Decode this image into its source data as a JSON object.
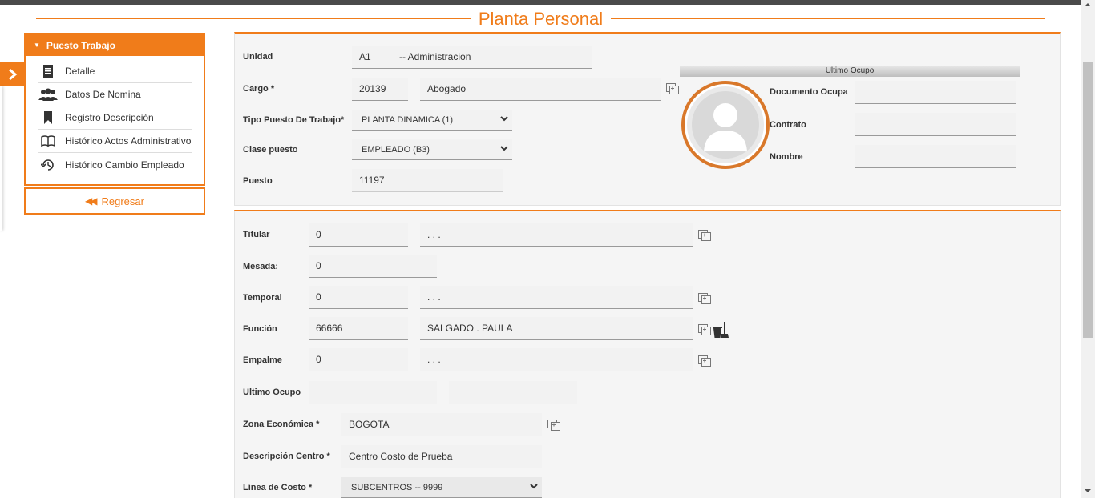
{
  "page": {
    "title": "Planta Personal"
  },
  "sidebar": {
    "header": "Puesto Trabajo",
    "items": [
      {
        "label": "Detalle",
        "icon": "document-icon"
      },
      {
        "label": "Datos De Nomina",
        "icon": "users-icon"
      },
      {
        "label": "Registro Descripción",
        "icon": "bookmark-icon"
      },
      {
        "label": "Histórico Actos Administrativo",
        "icon": "book-icon"
      },
      {
        "label": "Histórico Cambio Empleado",
        "icon": "history-icon"
      }
    ],
    "back_label": "Regresar"
  },
  "form1": {
    "unidad_label": "Unidad",
    "unidad_code": "A1",
    "unidad_name": "-- Administracion",
    "cargo_label": "Cargo *",
    "cargo_code": "20139",
    "cargo_name": "Abogado",
    "tipo_label": "Tipo Puesto De Trabajo*",
    "tipo_value": "PLANTA DINAMICA (1)",
    "clase_label": "Clase puesto",
    "clase_value": "EMPLEADO (B3)",
    "puesto_label": "Puesto",
    "puesto_value": "11197"
  },
  "ultimo_ocupo": {
    "header": "Ultimo Ocupo",
    "documento_label": "Documento Ocupa",
    "documento_value": "",
    "contrato_label": "Contrato",
    "contrato_value": "",
    "nombre_label": "Nombre",
    "nombre_value": ""
  },
  "form2": {
    "titular_label": "Titular",
    "titular_code": "0",
    "titular_name": ". . .",
    "mesada_label": "Mesada:",
    "mesada_value": "0",
    "temporal_label": "Temporal",
    "temporal_code": "0",
    "temporal_name": ". . .",
    "funcion_label": "Función",
    "funcion_code": "66666",
    "funcion_name": "SALGADO . PAULA",
    "empalme_label": "Empalme",
    "empalme_code": "0",
    "empalme_name": ". . .",
    "ultimo_label": "Ultimo Ocupo",
    "ultimo_value1": "",
    "ultimo_value2": "",
    "zona_label": "Zona Económica *",
    "zona_value": "BOGOTA",
    "centro_label": "Descripción Centro *",
    "centro_value": "Centro Costo de Prueba",
    "linea_label": "Línea de Costo *",
    "linea_value": "SUBCENTROS -- 9999"
  },
  "colors": {
    "accent": "#f07c1a"
  }
}
